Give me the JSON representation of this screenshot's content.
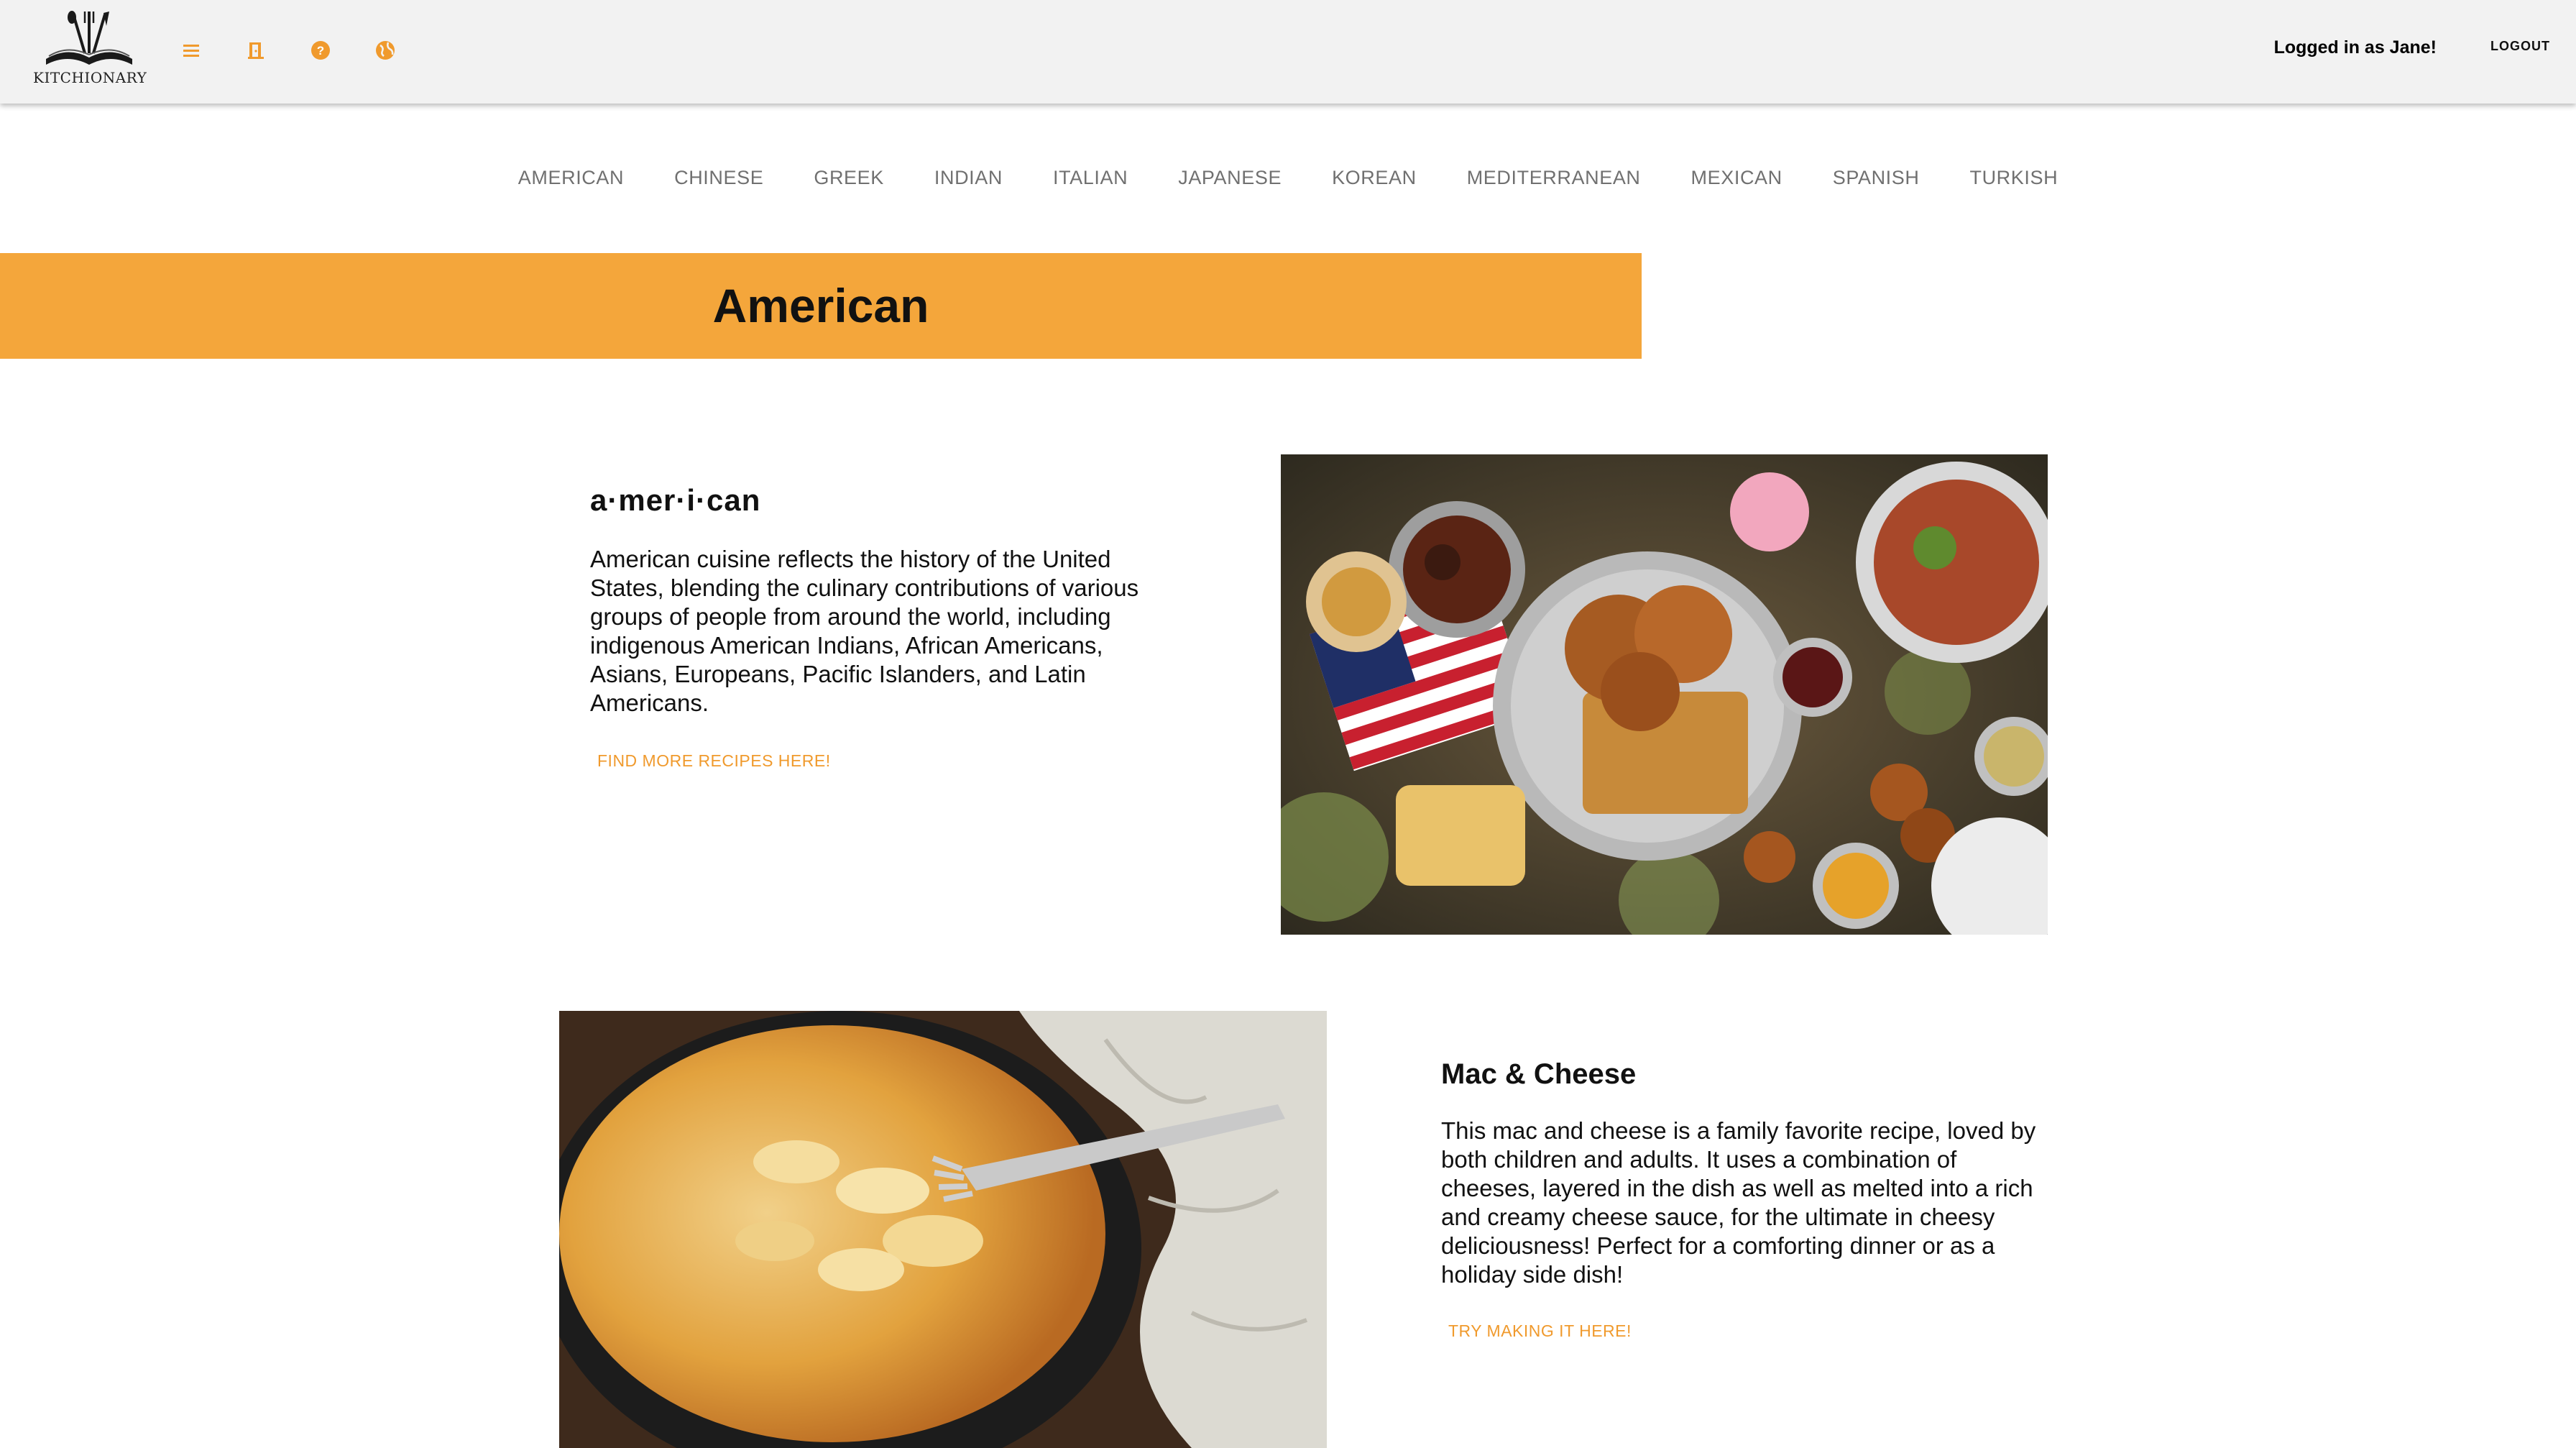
{
  "header": {
    "logo_text": "KITCHIONARY",
    "icons": [
      "menu-icon",
      "door-icon",
      "help-icon",
      "globe-icon"
    ],
    "user_label": "Logged in as Jane!",
    "logout_label": "LOGOUT",
    "accent_color": "#f4a63b"
  },
  "cuisines": [
    "AMERICAN",
    "CHINESE",
    "GREEK",
    "INDIAN",
    "ITALIAN",
    "JAPANESE",
    "KOREAN",
    "MEDITERRANEAN",
    "MEXICAN",
    "SPANISH",
    "TURKISH"
  ],
  "banner": {
    "title": "American"
  },
  "intro": {
    "word": "a·mer·i·can",
    "description": "American cuisine reflects the history of the United States, blending the culinary contributions of various groups of people from around the world, including indigenous American Indians, African Americans, Asians, Europeans, Pacific Islanders, and Latin Americans.",
    "link_label": "FIND MORE RECIPES HERE!"
  },
  "recipe": {
    "title": "Mac & Cheese",
    "description": "This mac and cheese is a family favorite recipe, loved by both children and adults. It uses a combination of cheeses, layered in the dish as well as melted into a rich and creamy cheese sauce, for the ultimate in cheesy deliciousness! Perfect for a comforting dinner or as a holiday side dish!",
    "link_label": "TRY MAKING IT HERE!"
  }
}
